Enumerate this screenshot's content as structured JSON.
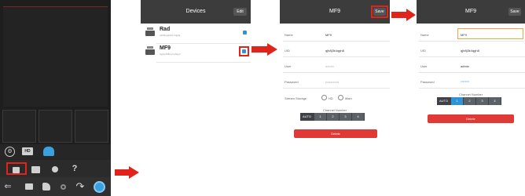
{
  "devices_screen": {
    "title": "Devices",
    "right_button": "Edit",
    "devices": [
      {
        "name": "Rad",
        "info": "q3h8pqj3qhq hqjqhj"
      },
      {
        "name": "MF9",
        "info": "hqjhq3h8pq hqhqp3"
      }
    ]
  },
  "edit_screen_1": {
    "title": "MF9",
    "right_button": "Save",
    "fields": [
      {
        "label": "Name",
        "value": "MF9",
        "placeholder": ""
      },
      {
        "label": "UID",
        "value": "qjh8j3k4qgh8",
        "placeholder": ""
      },
      {
        "label": "User",
        "value": "",
        "placeholder": "admin"
      },
      {
        "label": "Password",
        "value": "",
        "placeholder": "password"
      }
    ],
    "stream_label": "Stream Storage",
    "stream_options": [
      "HD",
      "Main"
    ],
    "channel_label": "Channel Number",
    "channels": [
      "AUTO",
      "1",
      "2",
      "3",
      "4"
    ],
    "button": "Delete"
  },
  "edit_screen_2": {
    "title": "MF9",
    "right_button": "Save",
    "fields": [
      {
        "label": "Name",
        "value": "MF9",
        "placeholder": ""
      },
      {
        "label": "UID",
        "value": "qjh8j3k4qgh8",
        "placeholder": ""
      },
      {
        "label": "User",
        "value": "admin",
        "placeholder": ""
      },
      {
        "label": "Password",
        "value": "",
        "placeholder": "••••••••"
      }
    ],
    "channel_label": "Channel Number",
    "channels": [
      "AUTO",
      "1",
      "2",
      "3",
      "4"
    ],
    "button": "Delete"
  },
  "live_screen": {
    "badge_label": "HD",
    "bottom_icons": [
      "back-icon",
      "camera-icon",
      "mic-icon",
      "talk-icon",
      "record-icon",
      "dial-icon"
    ]
  },
  "colors": {
    "highlight": "#e0241b",
    "navbar": "#3c3c3c",
    "delete_button": "#e03a37",
    "selected_channel": "#2f93d6"
  }
}
